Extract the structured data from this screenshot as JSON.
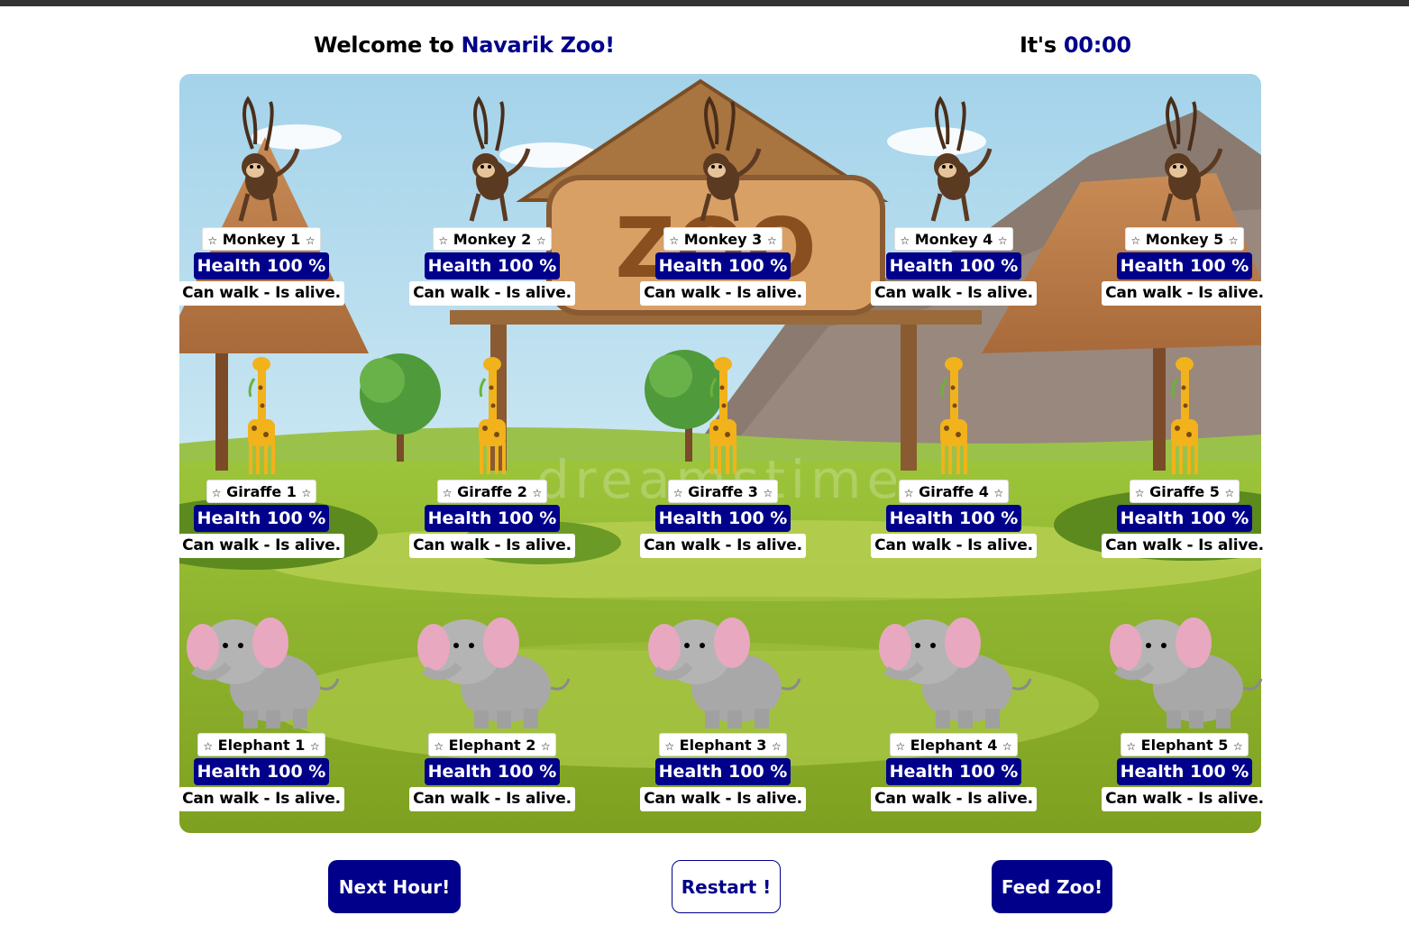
{
  "header": {
    "welcome_prefix": "Welcome to ",
    "zoo_name": "Navarik Zoo!",
    "clock_prefix": "It's ",
    "clock_time": "00:00"
  },
  "scene": {
    "sign_text": "ZOO",
    "watermark": "dreamstime"
  },
  "animals": {
    "monkeys": [
      {
        "name": "Monkey 1",
        "health": "Health 100 %",
        "status": "Can walk - Is alive."
      },
      {
        "name": "Monkey 2",
        "health": "Health 100 %",
        "status": "Can walk - Is alive."
      },
      {
        "name": "Monkey 3",
        "health": "Health 100 %",
        "status": "Can walk - Is alive."
      },
      {
        "name": "Monkey 4",
        "health": "Health 100 %",
        "status": "Can walk - Is alive."
      },
      {
        "name": "Monkey 5",
        "health": "Health 100 %",
        "status": "Can walk - Is alive."
      }
    ],
    "giraffes": [
      {
        "name": "Giraffe 1",
        "health": "Health 100 %",
        "status": "Can walk - Is alive."
      },
      {
        "name": "Giraffe 2",
        "health": "Health 100 %",
        "status": "Can walk - Is alive."
      },
      {
        "name": "Giraffe 3",
        "health": "Health 100 %",
        "status": "Can walk - Is alive."
      },
      {
        "name": "Giraffe 4",
        "health": "Health 100 %",
        "status": "Can walk - Is alive."
      },
      {
        "name": "Giraffe 5",
        "health": "Health 100 %",
        "status": "Can walk - Is alive."
      }
    ],
    "elephants": [
      {
        "name": "Elephant 1",
        "health": "Health 100 %",
        "status": "Can walk - Is alive."
      },
      {
        "name": "Elephant 2",
        "health": "Health 100 %",
        "status": "Can walk - Is alive."
      },
      {
        "name": "Elephant 3",
        "health": "Health 100 %",
        "status": "Can walk - Is alive."
      },
      {
        "name": "Elephant 4",
        "health": "Health 100 %",
        "status": "Can walk - Is alive."
      },
      {
        "name": "Elephant 5",
        "health": "Health 100 %",
        "status": "Can walk - Is alive."
      }
    ]
  },
  "buttons": {
    "next_hour": "Next Hour!",
    "restart": "Restart !",
    "feed": "Feed Zoo!"
  },
  "colors": {
    "accent": "#00008b",
    "sky": "#a8d5ea",
    "grass": "#8fb52a"
  }
}
